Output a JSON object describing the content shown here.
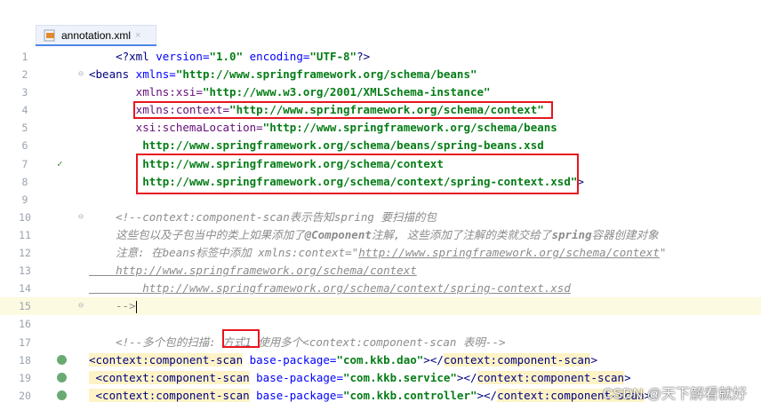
{
  "tab": {
    "filename": "annotation.xml",
    "close": "×"
  },
  "lines": [
    {
      "n": "1",
      "mark": "",
      "parts": [
        [
          "c-plain",
          "    "
        ],
        [
          "c-tag",
          "<?xml"
        ],
        [
          "c-attr",
          " version="
        ],
        [
          "c-str",
          "\"1.0\""
        ],
        [
          "c-attr",
          " encoding="
        ],
        [
          "c-str",
          "\"UTF-8\""
        ],
        [
          "c-tag",
          "?>"
        ]
      ]
    },
    {
      "n": "2",
      "mark": "",
      "parts": [
        [
          "c-tag",
          "<beans"
        ],
        [
          "c-attr",
          " xmlns="
        ],
        [
          "c-str",
          "\"http://www.springframework.org/schema/beans\""
        ]
      ]
    },
    {
      "n": "3",
      "mark": "",
      "parts": [
        [
          "c-ns",
          "       xmlns:xsi="
        ],
        [
          "c-str",
          "\"http://www.w3.org/2001/XMLSchema-instance\""
        ]
      ]
    },
    {
      "n": "4",
      "mark": "",
      "parts": [
        [
          "c-ns",
          "       xmlns:context="
        ],
        [
          "c-str",
          "\"http://www.springframework.org/schema/context\""
        ]
      ]
    },
    {
      "n": "5",
      "mark": "",
      "parts": [
        [
          "c-ns",
          "       xsi:schemaLocation="
        ],
        [
          "c-str",
          "\"http://www.springframework.org/schema/beans"
        ]
      ]
    },
    {
      "n": "6",
      "mark": "",
      "parts": [
        [
          "c-str",
          "        http://www.springframework.org/schema/beans/spring-beans.xsd"
        ]
      ]
    },
    {
      "n": "7",
      "mark": "✓",
      "parts": [
        [
          "c-str",
          "        http://www.springframework.org/schema/context"
        ]
      ]
    },
    {
      "n": "8",
      "mark": "",
      "parts": [
        [
          "c-str",
          "        http://www.springframework.org/schema/context/spring-context.xsd\""
        ],
        [
          "c-tag",
          ">"
        ]
      ]
    },
    {
      "n": "9",
      "mark": "",
      "parts": []
    },
    {
      "n": "10",
      "mark": "",
      "parts": [
        [
          "c-com",
          "    <!--context:component-scan表示告知spring 要扫描的包"
        ]
      ]
    },
    {
      "n": "11",
      "mark": "",
      "parts": [
        [
          "c-com",
          "    这些包以及子包当中的类上如果添加了"
        ],
        [
          "c-com-b",
          "@Component"
        ],
        [
          "c-com",
          "注解, 这些添加了注解的类就交给了"
        ],
        [
          "c-com-b",
          "spring"
        ],
        [
          "c-com",
          "容器创建对象"
        ]
      ]
    },
    {
      "n": "12",
      "mark": "",
      "parts": [
        [
          "c-com",
          "    注意: 在beans标签中添加 xmlns:context=\""
        ],
        [
          "c-com-u",
          "http://www.springframework.org/schema/context"
        ],
        [
          "c-com",
          "\""
        ]
      ]
    },
    {
      "n": "13",
      "mark": "",
      "parts": [
        [
          "c-com-u",
          "    http://www.springframework.org/schema/context"
        ]
      ]
    },
    {
      "n": "14",
      "mark": "",
      "parts": [
        [
          "c-com-u",
          "        http://www.springframework.org/schema/context/spring-context.xsd"
        ]
      ]
    },
    {
      "n": "15",
      "mark": "",
      "parts": [
        [
          "c-com",
          "    -->"
        ]
      ]
    },
    {
      "n": "16",
      "mark": "",
      "parts": []
    },
    {
      "n": "17",
      "mark": "",
      "parts": [
        [
          "c-com",
          "    <!--多个包的扫描: 方式1 使用多个<context:component-scan 表明-->"
        ]
      ]
    },
    {
      "n": "18",
      "mark": "bean",
      "parts": [
        [
          "c-tag hl",
          "<context:component-scan"
        ],
        [
          "c-attr",
          " base-package="
        ],
        [
          "c-str",
          "\"com.kkb.dao\""
        ],
        [
          "c-tag",
          "></"
        ],
        [
          "c-tag hl",
          "context:component-scan"
        ],
        [
          "c-tag",
          ">"
        ]
      ]
    },
    {
      "n": "19",
      "mark": "bean",
      "parts": [
        [
          "c-tag hl",
          " <context:component-scan"
        ],
        [
          "c-attr",
          " base-package="
        ],
        [
          "c-str",
          "\"com.kkb.service\""
        ],
        [
          "c-tag",
          "></"
        ],
        [
          "c-tag hl",
          "context:component-scan"
        ],
        [
          "c-tag",
          ">"
        ]
      ]
    },
    {
      "n": "20",
      "mark": "bean",
      "parts": [
        [
          "c-tag hl",
          " <context:component-scan"
        ],
        [
          "c-attr",
          " base-package="
        ],
        [
          "c-str",
          "\"com.kkb.controller\""
        ],
        [
          "c-tag",
          "></"
        ],
        [
          "c-tag hl",
          "context:component-scan"
        ],
        [
          "c-tag",
          ">"
        ]
      ]
    }
  ],
  "watermark": "CSDN @天下解看就好"
}
